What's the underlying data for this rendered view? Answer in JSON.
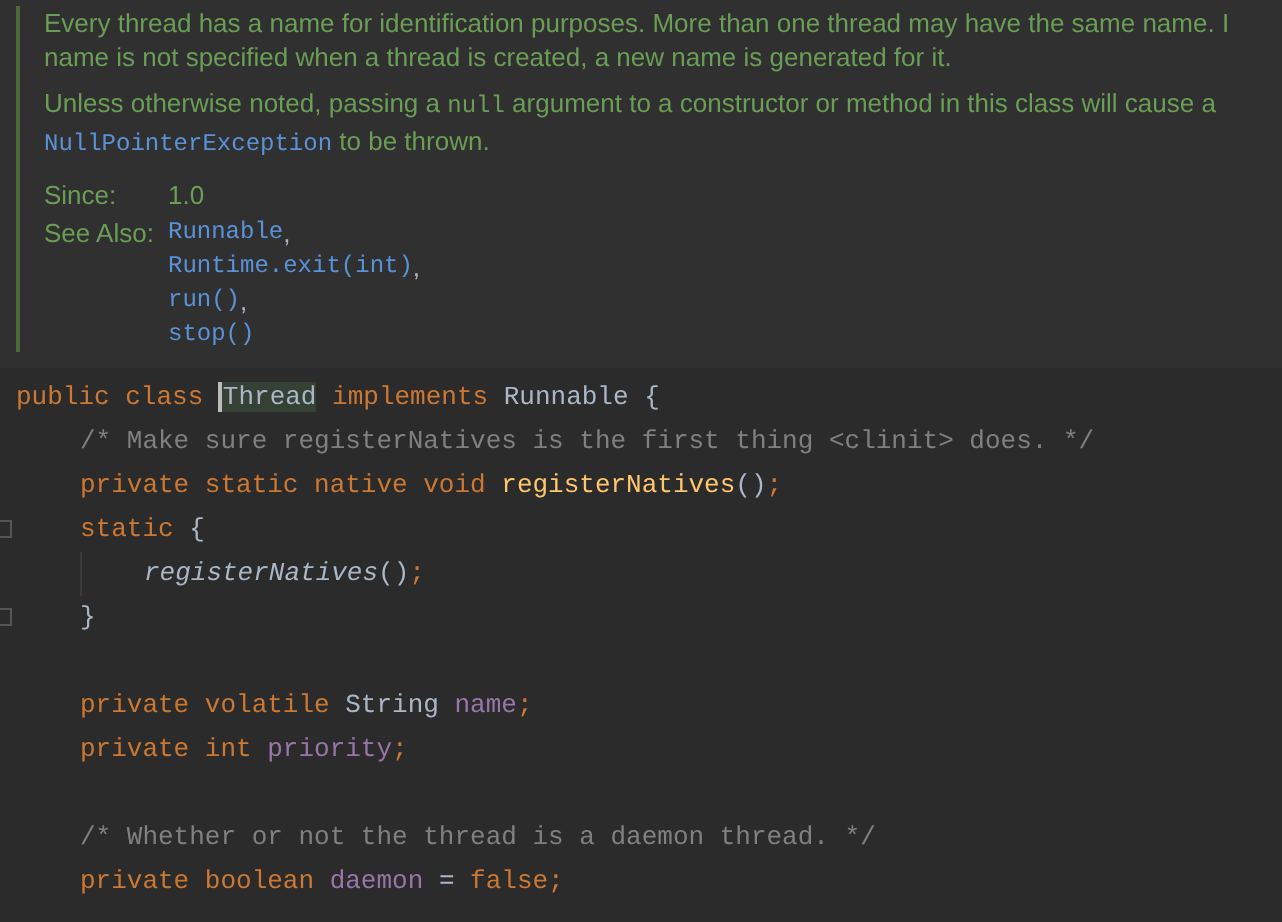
{
  "doc": {
    "paragraphs": [
      {
        "lines": [
          [
            {
              "kind": "text",
              "text": "Every thread has a name for identification purposes. More than one thread may have the same name. I"
            }
          ],
          [
            {
              "kind": "text",
              "text": "name is not specified when a thread is created, a new name is generated for it."
            }
          ]
        ]
      },
      {
        "lines": [
          [
            {
              "kind": "text",
              "text": "Unless otherwise noted, passing a "
            },
            {
              "kind": "code",
              "text": "null"
            },
            {
              "kind": "text",
              "text": " argument to a constructor or method in this class will cause a"
            }
          ],
          [
            {
              "kind": "link",
              "text": "NullPointerException"
            },
            {
              "kind": "text",
              "text": " to be thrown."
            }
          ]
        ]
      }
    ],
    "tags": [
      {
        "label": "Since:",
        "values": [
          {
            "kind": "text",
            "text": "1.0"
          }
        ]
      },
      {
        "label": "See Also:",
        "values": [
          {
            "kind": "link",
            "text": "Runnable",
            "suffix": ","
          },
          {
            "kind": "link",
            "text": "Runtime.exit(int)",
            "suffix": ","
          },
          {
            "kind": "link",
            "text": "run()",
            "suffix": ","
          },
          {
            "kind": "link",
            "text": "stop()"
          }
        ]
      }
    ]
  },
  "code": [
    {
      "kind": "code",
      "tokens": [
        {
          "kind": "keyword",
          "text": "public class "
        },
        {
          "kind": "selected",
          "text": "Thread"
        },
        {
          "kind": "keyword",
          "text": " implements "
        },
        {
          "kind": "plain",
          "text": "Runnable {"
        }
      ],
      "children": [
        {
          "kind": "code",
          "tokens": [
            {
              "kind": "comment",
              "text": "/* Make sure registerNatives is the first thing <clinit> does. */"
            }
          ]
        },
        {
          "kind": "code",
          "tokens": [
            {
              "kind": "keyword",
              "text": "private static native void "
            },
            {
              "kind": "method",
              "text": "registerNatives"
            },
            {
              "kind": "plain",
              "text": "()"
            },
            {
              "kind": "keyword",
              "text": ";"
            }
          ]
        },
        {
          "kind": "code",
          "fold": true,
          "tokens": [
            {
              "kind": "keyword",
              "text": "static "
            },
            {
              "kind": "plain",
              "text": "{"
            }
          ],
          "children": [
            {
              "kind": "code",
              "tokens": [
                {
                  "kind": "call",
                  "text": "registerNatives"
                },
                {
                  "kind": "plain",
                  "text": "()"
                },
                {
                  "kind": "keyword",
                  "text": ";"
                }
              ]
            }
          ]
        },
        {
          "kind": "code",
          "fold": true,
          "tokens": [
            {
              "kind": "plain",
              "text": "}"
            }
          ]
        },
        {
          "kind": "blank"
        },
        {
          "kind": "code",
          "tokens": [
            {
              "kind": "keyword",
              "text": "private volatile "
            },
            {
              "kind": "plain",
              "text": "String "
            },
            {
              "kind": "field",
              "text": "name"
            },
            {
              "kind": "keyword",
              "text": ";"
            }
          ]
        },
        {
          "kind": "code",
          "tokens": [
            {
              "kind": "keyword",
              "text": "private int "
            },
            {
              "kind": "field",
              "text": "priority"
            },
            {
              "kind": "keyword",
              "text": ";"
            }
          ]
        },
        {
          "kind": "blank"
        },
        {
          "kind": "code",
          "tokens": [
            {
              "kind": "comment",
              "text": "/* Whether or not the thread is a daemon thread. */"
            }
          ]
        },
        {
          "kind": "code",
          "tokens": [
            {
              "kind": "keyword",
              "text": "private boolean "
            },
            {
              "kind": "field",
              "text": "daemon"
            },
            {
              "kind": "plain",
              "text": " = "
            },
            {
              "kind": "keyword",
              "text": "false;"
            }
          ]
        }
      ]
    }
  ]
}
